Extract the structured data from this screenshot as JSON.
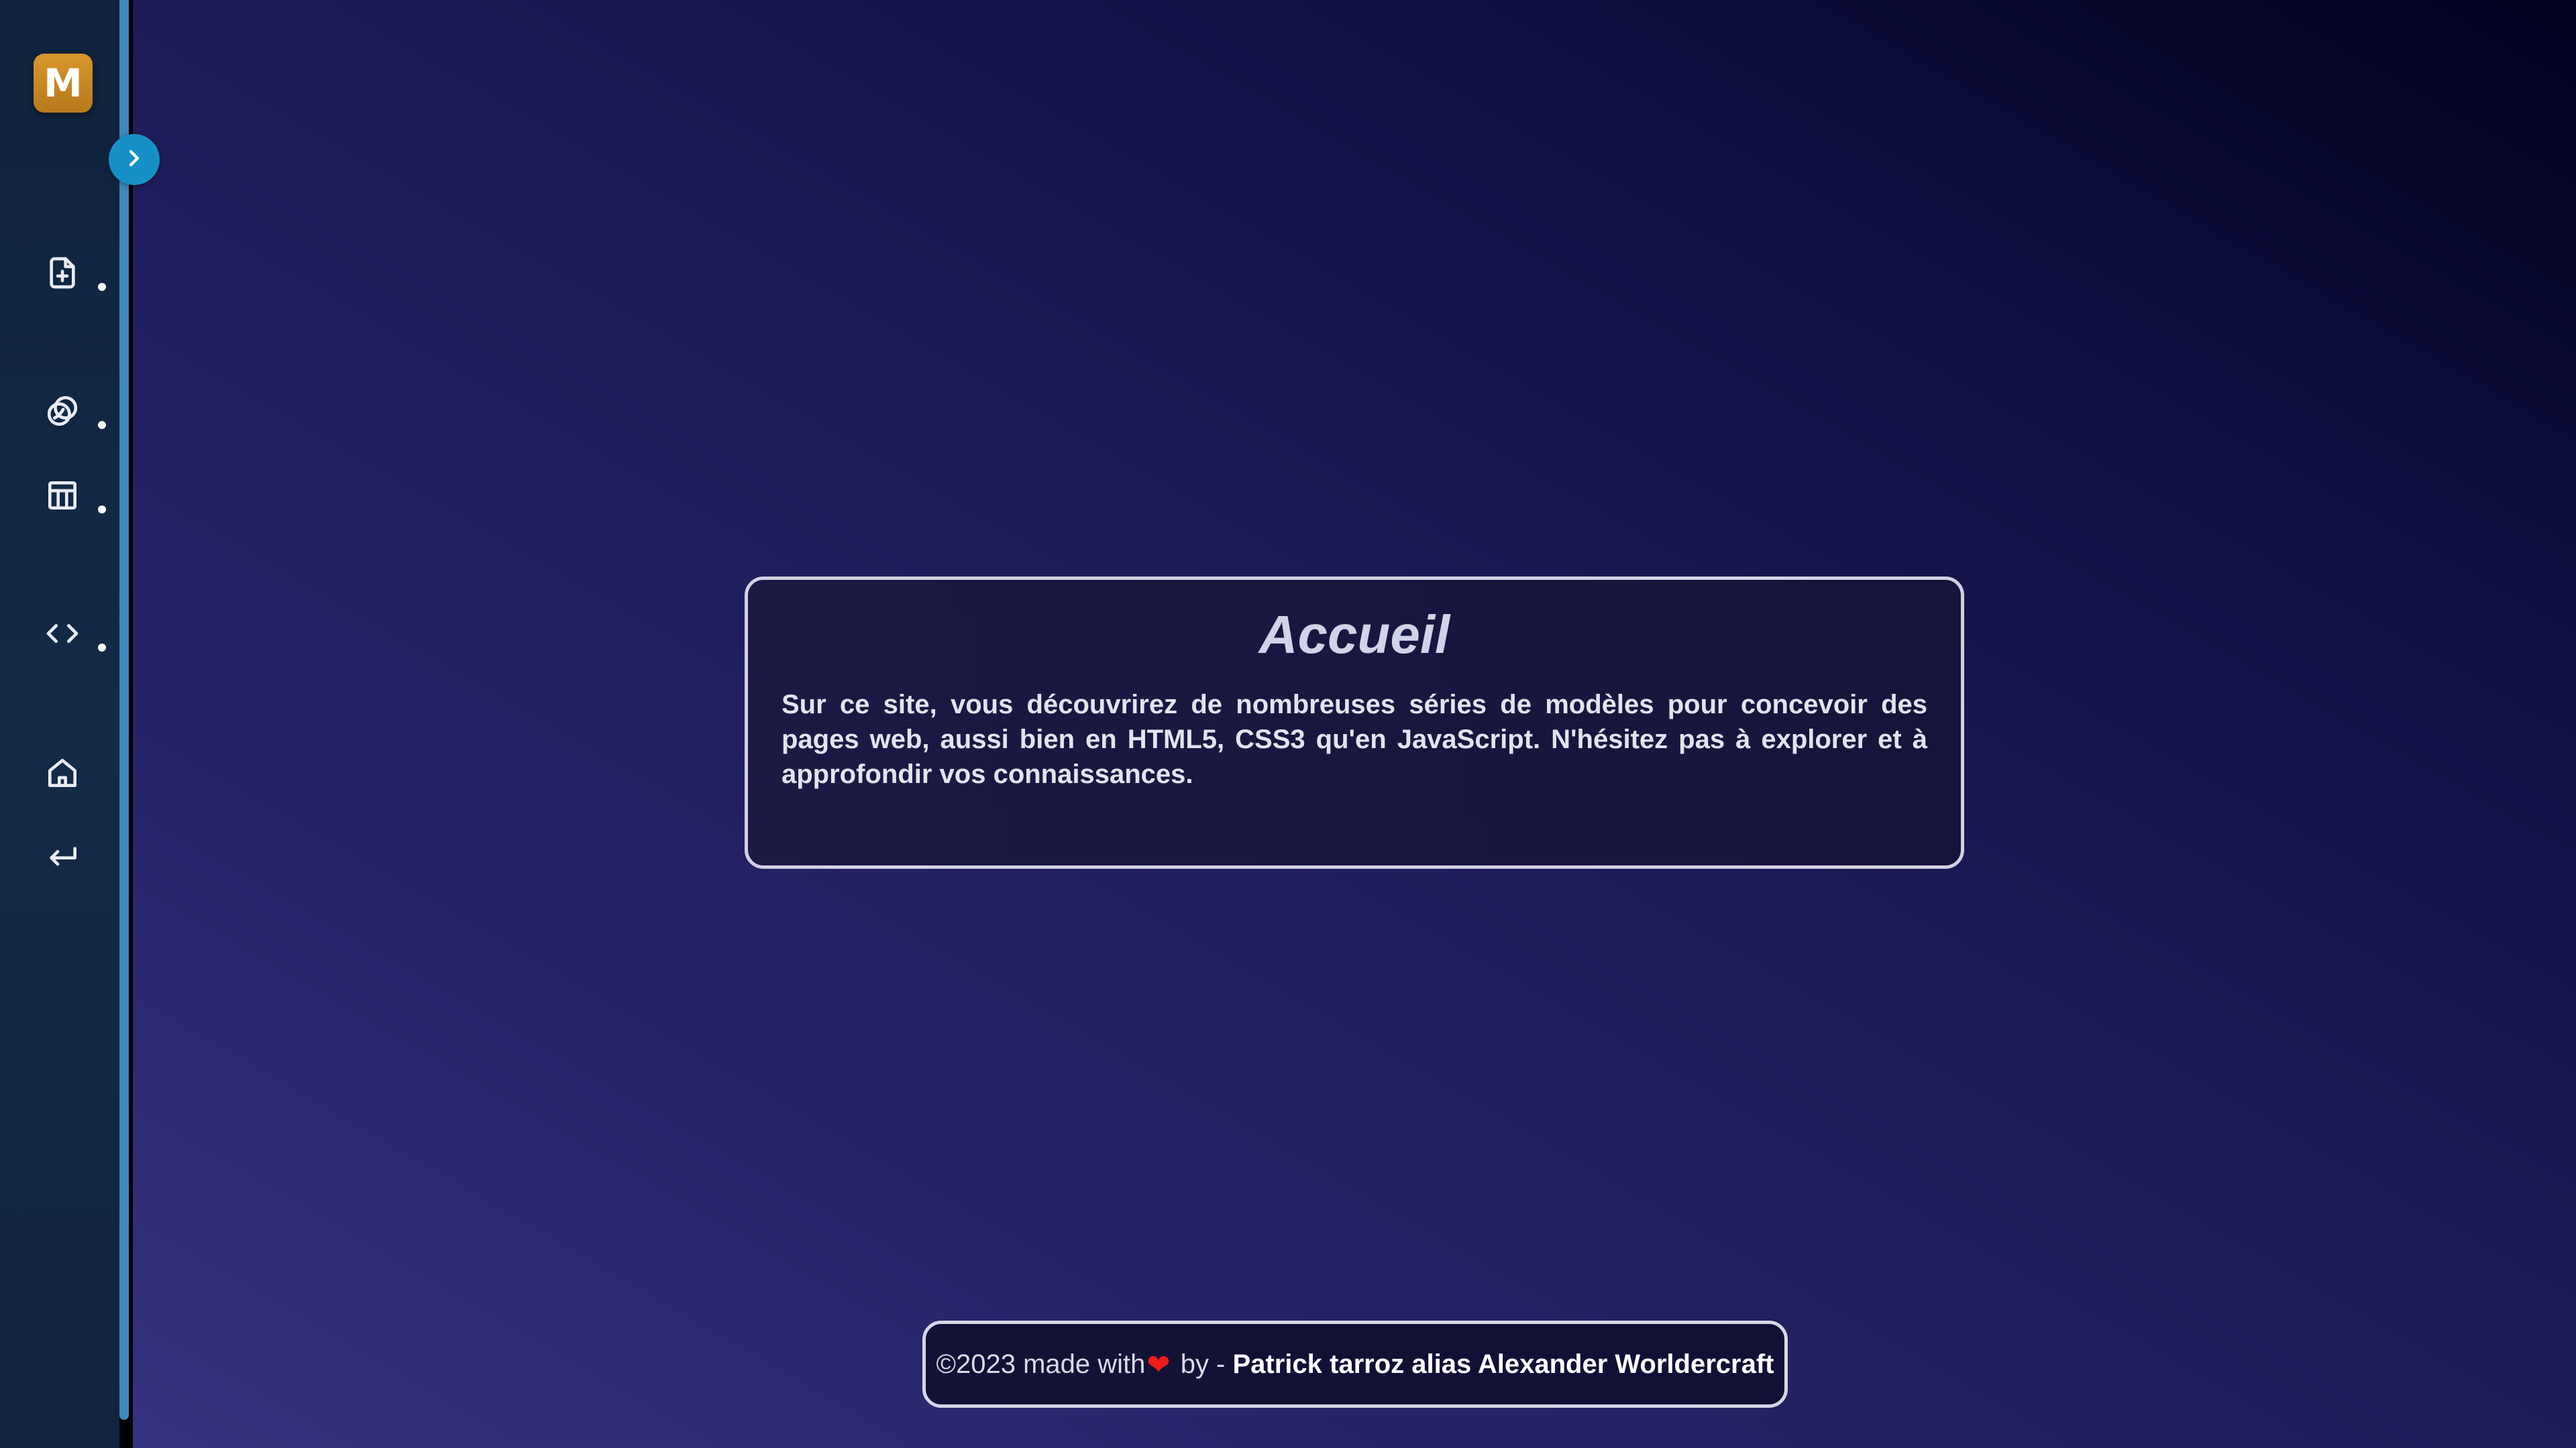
{
  "app": {
    "logo_letter": "M",
    "brand_color": "#c88a24",
    "accent_color": "#1691c8"
  },
  "sidebar": {
    "toggle_icon": "chevron-right-icon",
    "items": [
      {
        "name": "new-file",
        "icon": "file-plus-icon"
      },
      {
        "name": "overlapping-circles",
        "icon": "overlapping-circles-icon"
      },
      {
        "name": "layout",
        "icon": "columns-layout-icon"
      },
      {
        "name": "code",
        "icon": "code-brackets-icon"
      },
      {
        "name": "home",
        "icon": "home-icon"
      },
      {
        "name": "return",
        "icon": "return-arrow-icon"
      }
    ]
  },
  "main": {
    "title": "Accueil",
    "description": "Sur ce site, vous découvrirez de nombreuses séries de modèles pour concevoir des pages web, aussi bien en HTML5, CSS3 qu'en JavaScript. N'hésitez pas à explorer et à approfondir vos connaissances."
  },
  "footer": {
    "prefix": "©2023 made with",
    "heart_icon": "heart-icon",
    "by_text": " by - ",
    "author": "Patrick tarroz alias Alexander Worldercraft",
    "heart_color": "#ee1c1c"
  }
}
